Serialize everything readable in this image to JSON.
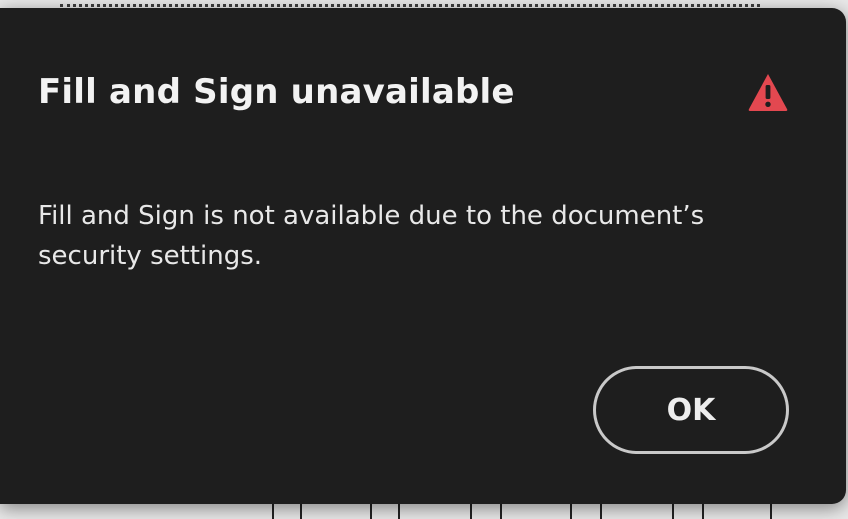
{
  "dialog": {
    "title": "Fill and Sign unavailable",
    "message": "Fill and Sign is not available due to the document’s security settings.",
    "ok_label": "OK",
    "icon": "warning-icon"
  },
  "colors": {
    "dialog_bg": "#1e1e1e",
    "warning": "#e34850",
    "text": "#f2f2f2",
    "button_border": "#c9c9c9"
  }
}
